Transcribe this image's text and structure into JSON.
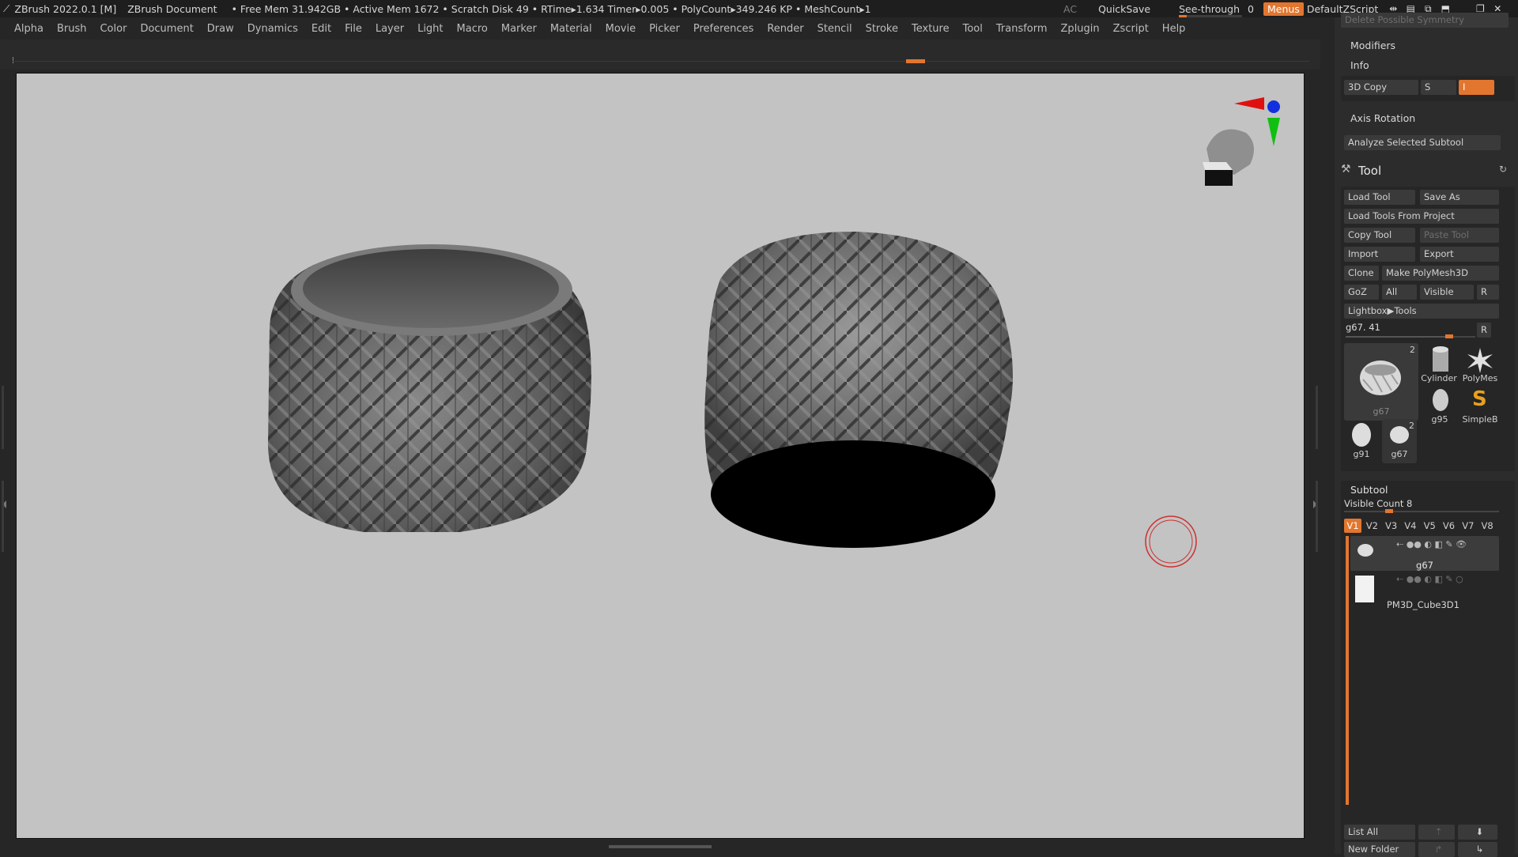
{
  "titlebar": {
    "app": "ZBrush 2022.0.1 [M]",
    "document": "ZBrush Document",
    "stats": "• Free Mem 31.942GB • Active Mem 1672 • Scratch Disk 49 •  RTime▸1.634 Timer▸0.005 • PolyCount▸349.246 KP  • MeshCount▸1",
    "ac": "AC",
    "quicksave": "QuickSave",
    "seethrough_label": "See-through",
    "seethrough_value": "0",
    "seethrough_fraction": 0,
    "menus": "Menus",
    "script": "DefaultZScript"
  },
  "menubar": {
    "items": [
      "Alpha",
      "Brush",
      "Color",
      "Document",
      "Draw",
      "Dynamics",
      "Edit",
      "File",
      "Layer",
      "Light",
      "Macro",
      "Marker",
      "Material",
      "Movie",
      "Picker",
      "Preferences",
      "Render",
      "Stencil",
      "Stroke",
      "Texture",
      "Tool",
      "Transform",
      "Zplugin",
      "Zscript",
      "Help"
    ]
  },
  "tray": {
    "cut_top": "Delete Possible Symmetry",
    "modifiers": "Modifiers",
    "info": "Info",
    "copy3d": "3D Copy",
    "s_label": "S",
    "i_label": "I",
    "axis_rotation": "Axis Rotation",
    "analyze": "Analyze Selected Subtool",
    "tool_title": "Tool",
    "load_tool": "Load Tool",
    "save_as": "Save As",
    "load_from_project": "Load Tools From Project",
    "copy_tool": "Copy Tool",
    "paste_tool": "Paste Tool",
    "import": "Import",
    "export": "Export",
    "clone": "Clone",
    "make_polymesh": "Make PolyMesh3D",
    "goz": "GoZ",
    "all": "All",
    "visible": "Visible",
    "r": "R",
    "lightbox_tools": "Lightbox▶Tools",
    "tool_slider_label": "g67. 41",
    "tool_slider_fraction": 0.8,
    "thumbs": {
      "main_name": "g67",
      "main_count": "2",
      "cylinder": "Cylinder",
      "polymesh": "PolyMes",
      "g95": "g95",
      "simpleb": "SimpleB",
      "g91": "g91",
      "g67b": "g67",
      "g67b_count": "2"
    },
    "subtool_title": "Subtool",
    "visible_count": "Visible Count 8",
    "vtabs": [
      "V1",
      "V2",
      "V3",
      "V4",
      "V5",
      "V6",
      "V7",
      "V8"
    ],
    "subtools": [
      "g67",
      "PM3D_Cube3D1"
    ],
    "list_all": "List All",
    "new_folder": "New Folder"
  }
}
